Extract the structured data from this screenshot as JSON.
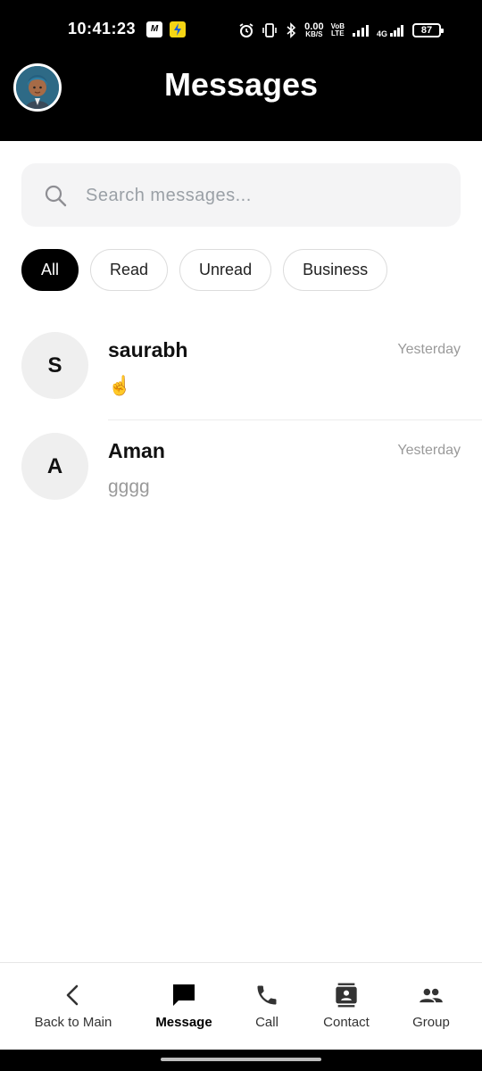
{
  "status_bar": {
    "time": "10:41:23",
    "net_speed": "0.00",
    "net_unit": "KB/S",
    "volte_top": "VoB",
    "volte_bottom": "LTE",
    "network": "4G",
    "battery": "87"
  },
  "header": {
    "title": "Messages"
  },
  "search": {
    "placeholder": "Search messages..."
  },
  "filters": [
    {
      "label": "All",
      "active": true
    },
    {
      "label": "Read",
      "active": false
    },
    {
      "label": "Unread",
      "active": false
    },
    {
      "label": "Business",
      "active": false
    }
  ],
  "conversations": [
    {
      "initial": "S",
      "name": "saurabh",
      "time": "Yesterday",
      "preview": "☝️"
    },
    {
      "initial": "A",
      "name": "Aman",
      "time": "Yesterday",
      "preview": "gggg"
    }
  ],
  "bottom_nav": [
    {
      "label": "Back to Main",
      "icon": "chevron-left-icon"
    },
    {
      "label": "Message",
      "icon": "message-icon",
      "active": true
    },
    {
      "label": "Call",
      "icon": "phone-icon"
    },
    {
      "label": "Contact",
      "icon": "contact-card-icon"
    },
    {
      "label": "Group",
      "icon": "group-icon"
    }
  ],
  "colors": {
    "header_bg": "#000000",
    "active_chip_bg": "#000000",
    "muted_text": "#9a9a9a",
    "search_bg": "#f4f4f5"
  }
}
